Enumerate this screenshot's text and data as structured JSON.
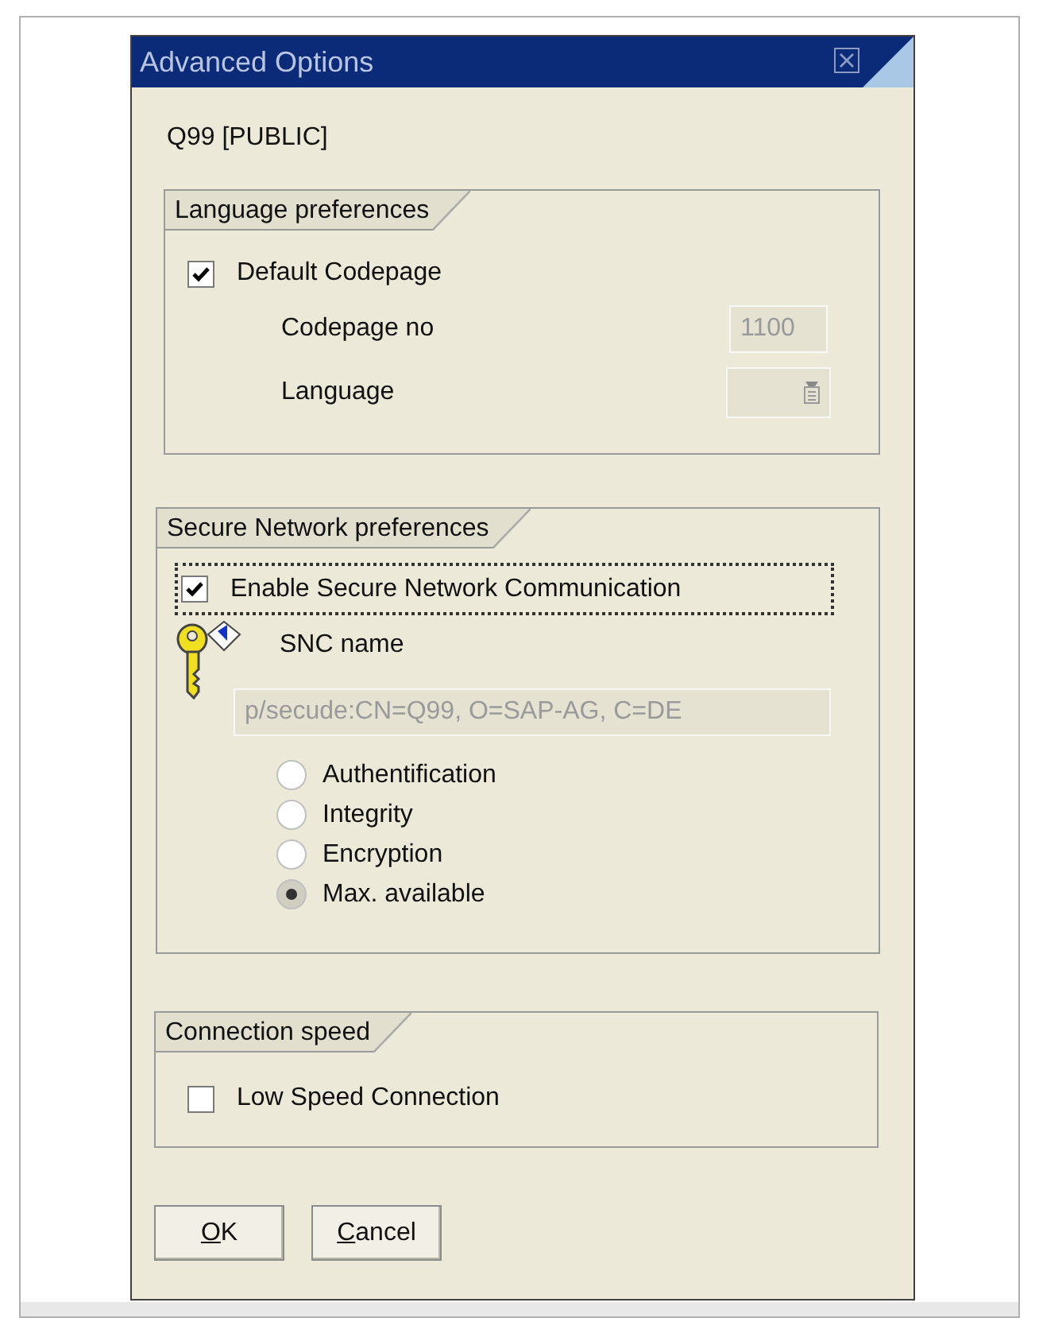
{
  "window": {
    "title": "Advanced Options"
  },
  "system": "Q99 [PUBLIC]",
  "language_preferences": {
    "title": "Language preferences",
    "default_codepage": {
      "label": "Default Codepage",
      "checked": true
    },
    "codepage_no": {
      "label": "Codepage no",
      "value": "1100",
      "disabled": true
    },
    "language": {
      "label": "Language",
      "disabled": true
    }
  },
  "secure_network": {
    "title": "Secure Network preferences",
    "enable_snc": {
      "label": "Enable Secure Network Communication",
      "checked": true,
      "focused": true
    },
    "snc_name": {
      "label": "SNC name",
      "value": "p/secude:CN=Q99, O=SAP-AG, C=DE",
      "disabled": true
    },
    "protection": [
      {
        "label": "Authentification",
        "selected": false
      },
      {
        "label": "Integrity",
        "selected": false
      },
      {
        "label": "Encryption",
        "selected": false
      },
      {
        "label": "Max. available",
        "selected": true
      }
    ]
  },
  "connection_speed": {
    "title": "Connection speed",
    "low_speed": {
      "label": "Low Speed Connection",
      "checked": false
    }
  },
  "buttons": [
    {
      "label": "OK"
    },
    {
      "label": "Cancel"
    }
  ]
}
